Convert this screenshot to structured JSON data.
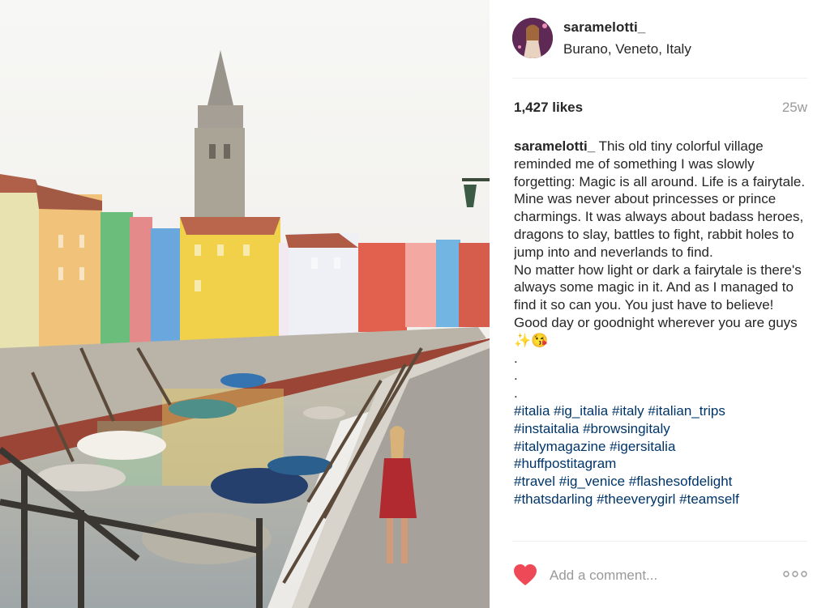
{
  "post": {
    "username": "saramelotti_",
    "location": "Burano, Veneto, Italy",
    "likes": "1,427 likes",
    "age": "25w",
    "caption_author": "saramelotti_",
    "caption_lines": [
      "This old tiny colorful village reminded me of something I was slowly forgetting: Magic is all around. Life is a fairytale.",
      "Mine was never about princesses or prince charmings. It was always about badass heroes, dragons to slay, battles to fight, rabbit holes to jump into and neverlands to find.",
      "No matter how light or dark a fairytale is there's always some magic in it. And as I managed to find it so can you. You just have to believe! Good day or goodnight wherever you are guys ✨😘",
      ".",
      ".",
      "."
    ],
    "hashtags": [
      "#italia",
      "#ig_italia",
      "#italy",
      "#italian_trips",
      "#instaitalia",
      "#browsingitaly",
      "#italymagazine",
      "#igersitalia",
      "#huffpostitagram",
      "#travel",
      "#ig_venice",
      "#flashesofdelight",
      "#thatsdarling",
      "#theeverygirl",
      "#teamself"
    ]
  },
  "footer": {
    "comment_placeholder": "Add a comment...",
    "like_icon": "heart-icon",
    "more_icon": "more-options-icon"
  },
  "colors": {
    "heart": "#ed4956",
    "hashtag": "#003569",
    "muted": "#999999"
  }
}
